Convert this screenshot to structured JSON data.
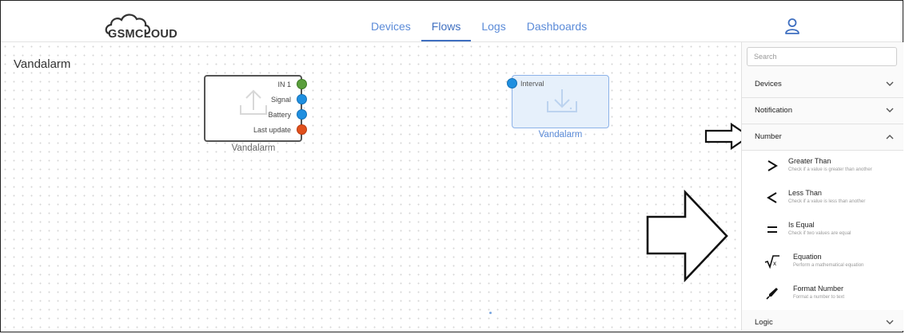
{
  "logo": {
    "text": "GSMCLOUD"
  },
  "nav": {
    "tabs": [
      "Devices",
      "Flows",
      "Logs",
      "Dashboards"
    ],
    "active": "Flows"
  },
  "canvas": {
    "title": "Vandalarm",
    "nodes": [
      {
        "name": "Vandalarm",
        "ports": [
          {
            "label": "IN 1",
            "color": "#5a9e3c"
          },
          {
            "label": "Signal",
            "color": "#1f8fe0"
          },
          {
            "label": "Battery",
            "color": "#1f8fe0"
          },
          {
            "label": "Last update",
            "color": "#e0501c"
          }
        ]
      },
      {
        "name": "Vandalarm",
        "ports": [
          {
            "label": "Interval",
            "color": "#1f8fe0"
          }
        ]
      }
    ]
  },
  "sidebar": {
    "search_placeholder": "Search",
    "categories": [
      {
        "label": "Devices",
        "expanded": false
      },
      {
        "label": "Notification",
        "expanded": false
      },
      {
        "label": "Number",
        "expanded": true
      },
      {
        "label": "Logic",
        "expanded": false
      }
    ],
    "number_items": [
      {
        "icon": "greater-than-icon",
        "title": "Greater Than",
        "desc": "Check if a value is greater than another"
      },
      {
        "icon": "less-than-icon",
        "title": "Less Than",
        "desc": "Check if a value is less than another"
      },
      {
        "icon": "equals-icon",
        "title": "Is Equal",
        "desc": "Check if two values are equal"
      },
      {
        "icon": "square-root-icon",
        "title": "Equation",
        "desc": "Perform a mathematical equation"
      },
      {
        "icon": "pen-icon",
        "title": "Format Number",
        "desc": "Format a number to text"
      }
    ]
  },
  "colors": {
    "nav": "#5b8bd8",
    "accent": "#3f6fc0",
    "port_blue": "#1f8fe0",
    "port_green": "#5a9e3c",
    "port_orange": "#e0501c",
    "node_b_text": "#5b8bd8"
  }
}
